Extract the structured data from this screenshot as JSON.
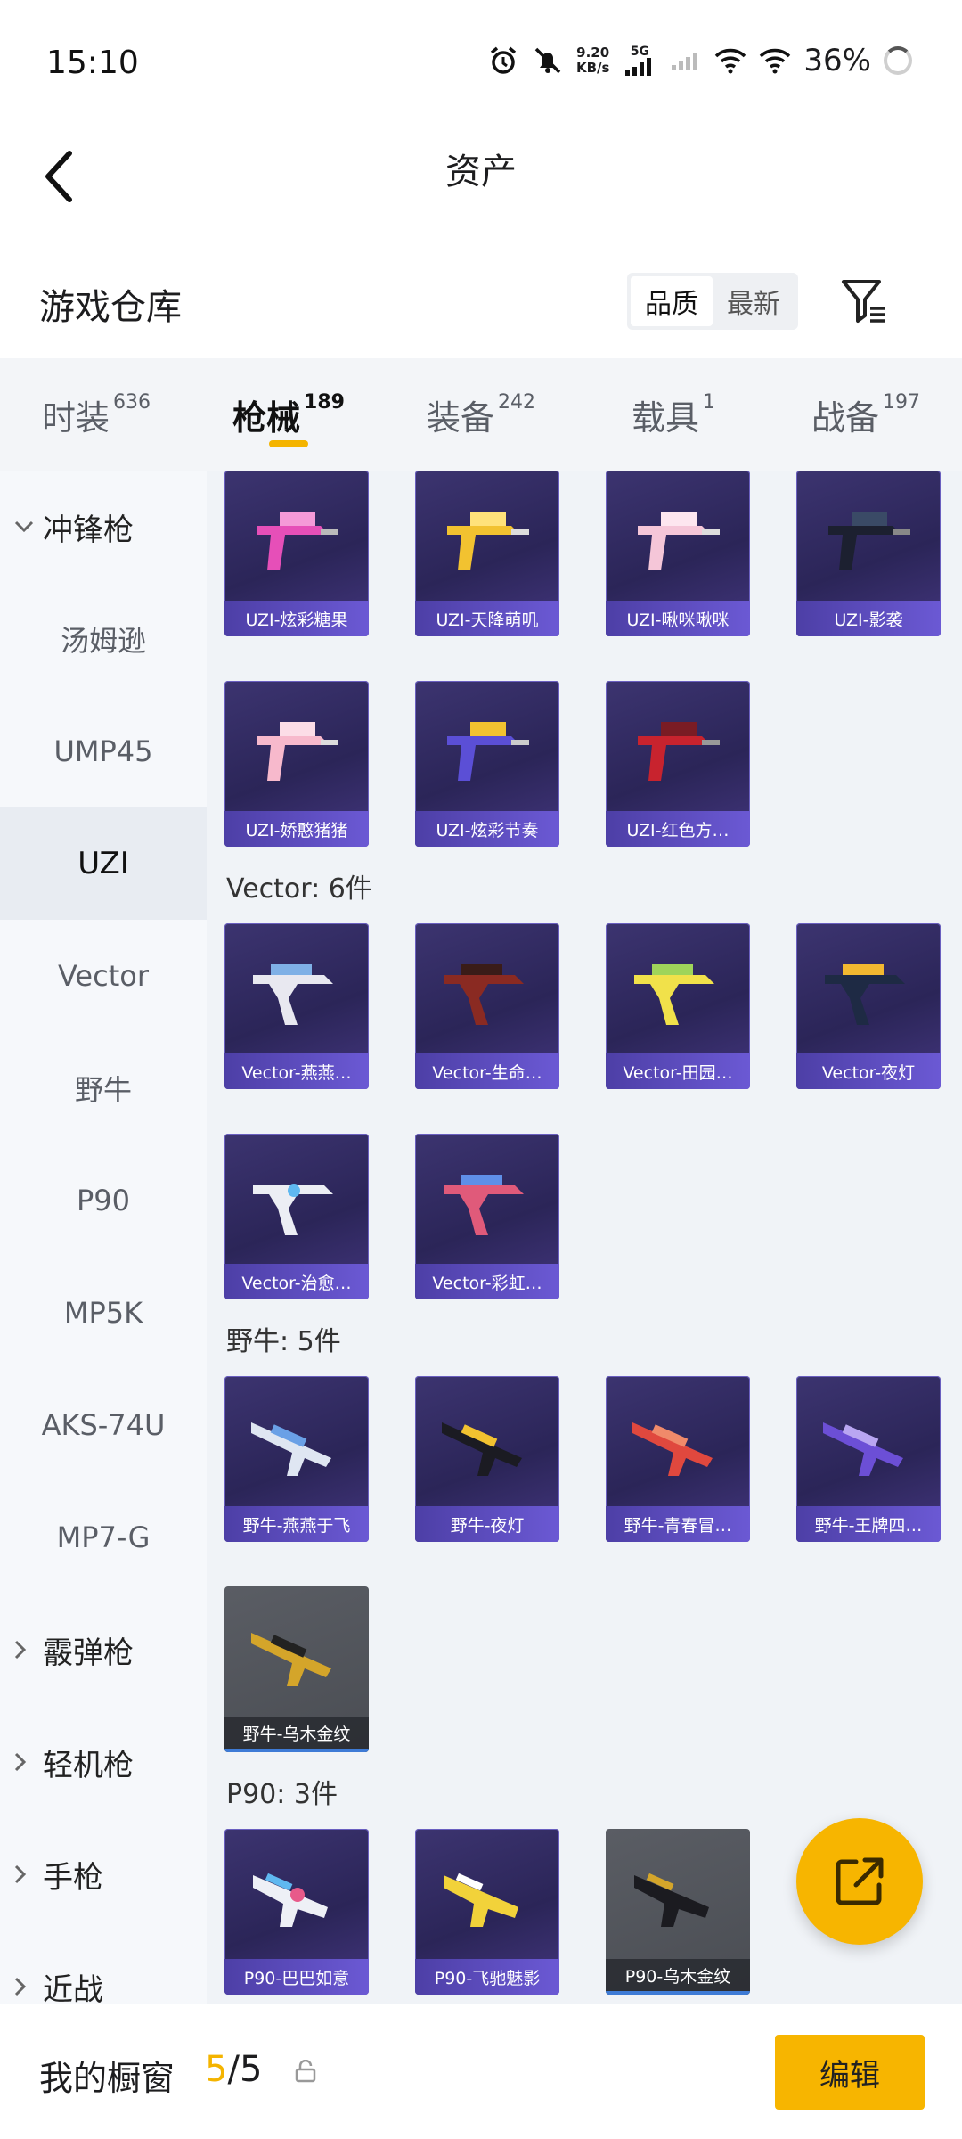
{
  "status_bar": {
    "time": "15:10",
    "net_speed_value": "9.20",
    "net_speed_unit": "KB/s",
    "network_type": "5G",
    "battery": "36%"
  },
  "nav": {
    "title": "资产"
  },
  "header": {
    "title": "游戏仓库",
    "sort_options": [
      "品质",
      "最新"
    ],
    "active_sort": "品质"
  },
  "tabs": [
    {
      "label": "时装",
      "count": "636"
    },
    {
      "label": "枪械",
      "count": "189"
    },
    {
      "label": "装备",
      "count": "242"
    },
    {
      "label": "载具",
      "count": "1"
    },
    {
      "label": "战备",
      "count": "197"
    }
  ],
  "active_tab": "枪械",
  "sidebar": [
    {
      "label": "冲锋枪",
      "type": "group",
      "expanded": true
    },
    {
      "label": "汤姆逊"
    },
    {
      "label": "UMP45"
    },
    {
      "label": "UZI",
      "active": true
    },
    {
      "label": "Vector"
    },
    {
      "label": "野牛"
    },
    {
      "label": "P90"
    },
    {
      "label": "MP5K"
    },
    {
      "label": "AKS-74U"
    },
    {
      "label": "MP7-G"
    },
    {
      "label": "霰弹枪",
      "type": "group"
    },
    {
      "label": "轻机枪",
      "type": "group"
    },
    {
      "label": "手枪",
      "type": "group"
    },
    {
      "label": "近战",
      "type": "group"
    }
  ],
  "groups": {
    "uzi_items": [
      "UZI-炫彩糖果",
      "UZI-天降萌叽",
      "UZI-啾咪啾咪",
      "UZI-影袭",
      "UZI-娇憨猪猪",
      "UZI-炫彩节奏",
      "UZI-红色方…"
    ],
    "vector_title": "Vector: 6件",
    "vector_items": [
      "Vector-燕燕…",
      "Vector-生命…",
      "Vector-田园…",
      "Vector-夜灯",
      "Vector-治愈…",
      "Vector-彩虹…"
    ],
    "bison_title": "野牛: 5件",
    "bison_items": [
      "野牛-燕燕于飞",
      "野牛-夜灯",
      "野牛-青春冒…",
      "野牛-王牌四…",
      "野牛-乌木金纹"
    ],
    "p90_title": "P90: 3件",
    "p90_items": [
      "P90-巴巴如意",
      "P90-飞驰魅影",
      "P90-乌木金纹"
    ]
  },
  "bottom_bar": {
    "title": "我的橱窗",
    "current": "5",
    "separator": "/",
    "total": "5",
    "edit_label": "编辑"
  },
  "colors": {
    "accent": "#f7b500",
    "card_bg": "#2b2558",
    "card_label": "#5b4bc4",
    "sidebar_bg": "#f6f8fb",
    "content_bg": "#f0f3f7"
  }
}
